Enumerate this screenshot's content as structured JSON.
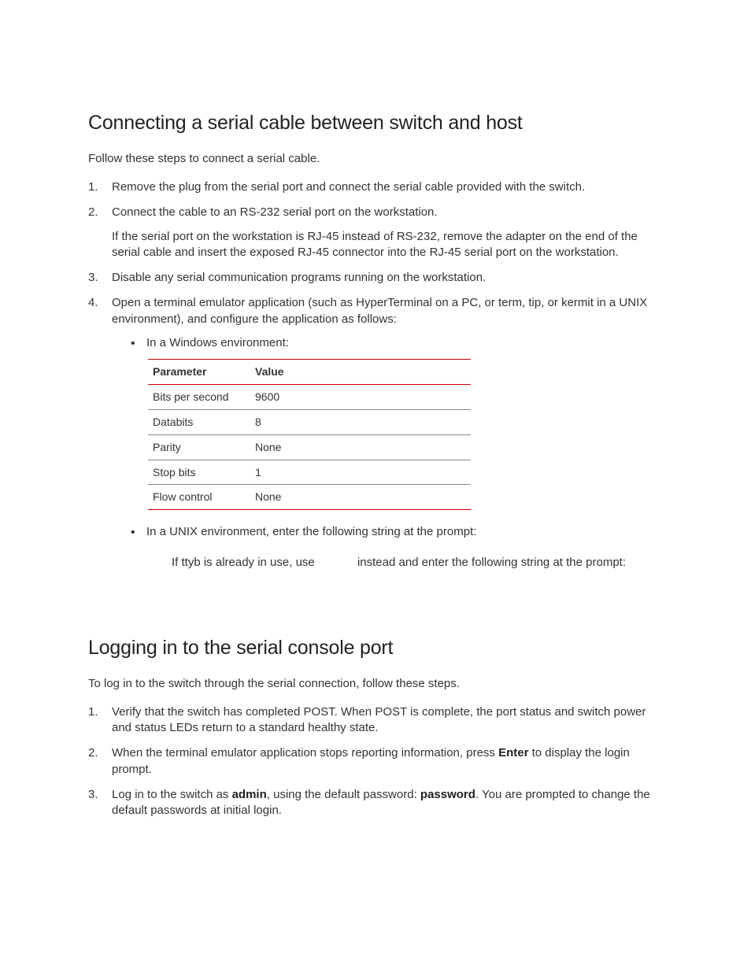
{
  "section1": {
    "heading": "Connecting a serial cable between switch and host",
    "intro": "Follow these steps to connect a serial cable.",
    "step1": "Remove the plug from the serial port and connect the serial cable provided with the switch.",
    "step2": "Connect the cable to an RS-232 serial port on the workstation.",
    "step2note": "If the serial port on the workstation is RJ-45 instead of RS-232, remove the adapter on the end of the serial cable and insert the exposed RJ-45 connector into the RJ-45 serial port on the workstation.",
    "step3": "Disable any serial communication programs running on the workstation.",
    "step4": "Open a terminal emulator application (such as HyperTerminal on a PC, or term, tip, or kermit in a UNIX environment), and configure the application as follows:",
    "bullet_windows": "In a Windows environment:",
    "table": {
      "h1": "Parameter",
      "h2": "Value",
      "rows": [
        {
          "p": "Bits per second",
          "v": "9600"
        },
        {
          "p": "Databits",
          "v": "8"
        },
        {
          "p": "Parity",
          "v": "None"
        },
        {
          "p": "Stop bits",
          "v": "1"
        },
        {
          "p": "Flow control",
          "v": "None"
        }
      ]
    },
    "bullet_unix": "In a UNIX environment, enter the following string at the prompt:",
    "unix_note_a": "If ttyb is already in use, use ",
    "unix_note_b": " instead and enter the following string at the prompt:"
  },
  "section2": {
    "heading": "Logging in to the serial console port",
    "intro": "To log in to the switch through the serial connection, follow these steps.",
    "step1": "Verify that the switch has completed POST. When POST is complete, the port status and switch power and status LEDs return to a standard healthy state.",
    "step2a": "When the terminal emulator application stops reporting information, press ",
    "step2_bold": "Enter",
    "step2b": " to display the login prompt.",
    "step3a": "Log in to the switch as ",
    "step3_bold1": "admin",
    "step3b": ", using the default password: ",
    "step3_bold2": "password",
    "step3c": ". You are prompted to change the default passwords at initial login."
  }
}
